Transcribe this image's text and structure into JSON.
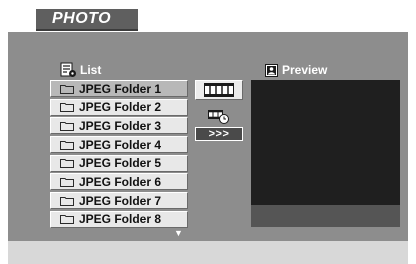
{
  "screen": {
    "title": "PHOTO"
  },
  "list": {
    "header": "List",
    "icon": "list-icon",
    "items": [
      {
        "label": "JPEG Folder 1",
        "icon": "folder-icon",
        "selected": true
      },
      {
        "label": "JPEG Folder 2",
        "icon": "folder-icon",
        "selected": false
      },
      {
        "label": "JPEG Folder 3",
        "icon": "folder-icon",
        "selected": false
      },
      {
        "label": "JPEG Folder 4",
        "icon": "folder-icon",
        "selected": false
      },
      {
        "label": "JPEG Folder 5",
        "icon": "folder-icon",
        "selected": false
      },
      {
        "label": "JPEG Folder 6",
        "icon": "folder-icon",
        "selected": false
      },
      {
        "label": "JPEG Folder 7",
        "icon": "folder-icon",
        "selected": false
      },
      {
        "label": "JPEG Folder 8",
        "icon": "folder-icon",
        "selected": false
      }
    ],
    "scroll_indicator": "▼"
  },
  "controls": {
    "filmstrip_icon": "filmstrip-icon",
    "slideshow_icon": "slideshow-icon",
    "next_label": ">>>"
  },
  "preview": {
    "header": "Preview",
    "icon": "preview-icon"
  },
  "colors": {
    "panel": "#8d8d8d",
    "title_tab": "#5f5f5f",
    "list_item": "#e8e8e8",
    "list_item_selected": "#b8b8b8",
    "preview_box": "#1f1f1f",
    "preview_caption": "#555555",
    "bottom_strip": "#d8d8d8"
  }
}
